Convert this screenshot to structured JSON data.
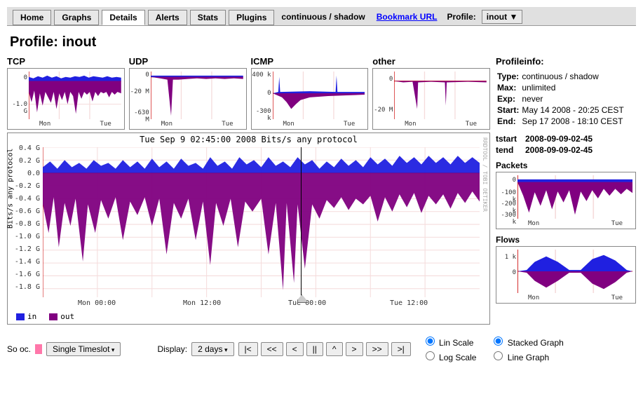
{
  "tabs": {
    "items": [
      "Home",
      "Graphs",
      "Details",
      "Alerts",
      "Stats",
      "Plugins"
    ],
    "active_index": 2,
    "mode": "continuous / shadow",
    "bookmark": "Bookmark URL",
    "profile_label": "Profile:",
    "profile_value": "inout ▼"
  },
  "page_title": "Profile: inout",
  "mini_charts": [
    {
      "title": "TCP",
      "yticks": [
        "0",
        "-1.0 G"
      ]
    },
    {
      "title": "UDP",
      "yticks": [
        "0",
        "-20 M",
        "-630 M"
      ]
    },
    {
      "title": "ICMP",
      "yticks": [
        "400 k",
        "0",
        "-300 k"
      ]
    },
    {
      "title": "other",
      "yticks": [
        "0",
        "-20 M"
      ]
    }
  ],
  "mini_xticks": [
    "Mon",
    "Tue"
  ],
  "big_chart": {
    "title": "Tue Sep  9 02:45:00 2008 Bits/s any protocol",
    "ylabel_rot": "Bits/s any protocol",
    "yticks": [
      "0.4 G",
      "0.2 G",
      "0.0",
      "-0.2 G",
      "-0.4 G",
      "-0.6 G",
      "-0.8 G",
      "-1.0 G",
      "-1.2 G",
      "-1.4 G",
      "-1.6 G",
      "-1.8 G"
    ],
    "xticks": [
      "Mon 00:00",
      "Mon 12:00",
      "Tue 00:00",
      "Tue 12:00"
    ],
    "legend": [
      {
        "label": "in",
        "color": "#2020e0"
      },
      {
        "label": "out",
        "color": "#800080"
      }
    ],
    "rrd_label": "RRDTOOL / TOBI OETIKER",
    "cursor_pct": 59
  },
  "profileinfo": {
    "heading": "Profileinfo:",
    "rows": [
      [
        "Type:",
        "continuous / shadow"
      ],
      [
        "Max:",
        "unlimited"
      ],
      [
        "Exp:",
        "never"
      ],
      [
        "Start:",
        "May 14 2008 - 20:25 CEST"
      ],
      [
        "End:",
        "Sep 17 2008 - 18:10 CEST"
      ]
    ]
  },
  "times": {
    "tstart_label": "tstart",
    "tstart": "2008-09-09-02-45",
    "tend_label": "tend",
    "tend": "2008-09-09-02-45"
  },
  "side_charts": [
    {
      "title": "Packets",
      "yticks": [
        "0",
        "-100 k",
        "-200 k",
        "-300 k"
      ]
    },
    {
      "title": "Flows",
      "yticks": [
        "1 k",
        "0"
      ]
    }
  ],
  "controls": {
    "source_sel": "Single Timeslot",
    "source_prefix": "So oc.",
    "display_label": "Display:",
    "display_value": "2 days",
    "nav_buttons": [
      "|<",
      "<<",
      "<",
      "||",
      "^",
      ">",
      ">>",
      ">|"
    ],
    "radios_left": [
      {
        "label": "Lin Scale",
        "checked": true
      },
      {
        "label": "Log Scale",
        "checked": false
      }
    ],
    "radios_right": [
      {
        "label": "Stacked Graph",
        "checked": true
      },
      {
        "label": "Line Graph",
        "checked": false
      }
    ]
  },
  "chart_data": [
    {
      "type": "area",
      "title": "TCP Bits/s",
      "ylim": [
        -1800000000,
        400000000
      ],
      "series": [
        {
          "name": "in",
          "color": "#2020e0",
          "approx": "0 to +0.3G noisy band"
        },
        {
          "name": "out",
          "color": "#800080",
          "approx": "0 to -1.8G heavy spikes"
        }
      ]
    },
    {
      "type": "area",
      "title": "UDP Bits/s",
      "ylim": [
        -700000000,
        50000000
      ],
      "series": [
        {
          "name": "in",
          "approx": "near 0"
        },
        {
          "name": "out",
          "approx": "bursts to -630M at Mon ~06:00"
        }
      ]
    },
    {
      "type": "area",
      "title": "ICMP Bits/s",
      "ylim": [
        -400000,
        450000
      ],
      "series": [
        {
          "name": "in",
          "approx": "spikes to +400k"
        },
        {
          "name": "out",
          "approx": "steady -50k to -300k dip"
        }
      ]
    },
    {
      "type": "area",
      "title": "other Bits/s",
      "ylim": [
        -25000000,
        5000000
      ],
      "series": [
        {
          "name": "in",
          "approx": "near 0"
        },
        {
          "name": "out",
          "approx": "occasional -20M spikes"
        }
      ]
    },
    {
      "type": "area",
      "title": "Bits/s any protocol",
      "x_range": "Mon 00:00 – Tue 24:00",
      "ylim": [
        -1800000000,
        450000000
      ],
      "yticks_g": [
        0.4,
        0.2,
        0.0,
        -0.2,
        -0.4,
        -0.6,
        -0.8,
        -1.0,
        -1.2,
        -1.4,
        -1.6,
        -1.8
      ],
      "xticks": [
        "Mon 00:00",
        "Mon 12:00",
        "Tue 00:00",
        "Tue 12:00"
      ],
      "series": [
        {
          "name": "in",
          "color": "#2020e0",
          "approx": "noisy band 0 to +0.4G, daytime bumps"
        },
        {
          "name": "out",
          "color": "#800080",
          "approx": "noisy 0 to -1.0G baseline with deep spikes to -1.8G around Tue 00:00–01:00"
        }
      ],
      "cursor_time": "Tue Sep 9 02:45:00 2008"
    },
    {
      "type": "area",
      "title": "Packets/s",
      "ylim": [
        -350000,
        50000
      ],
      "series": [
        {
          "name": "in",
          "approx": "thin positive band"
        },
        {
          "name": "out",
          "approx": "to -300k spikes"
        }
      ]
    },
    {
      "type": "area",
      "title": "Flows/s",
      "ylim": [
        -1200,
        1200
      ],
      "series": [
        {
          "name": "in",
          "approx": "two daytime humps to +1k"
        },
        {
          "name": "out",
          "approx": "mirror humps to -1k"
        }
      ]
    }
  ]
}
